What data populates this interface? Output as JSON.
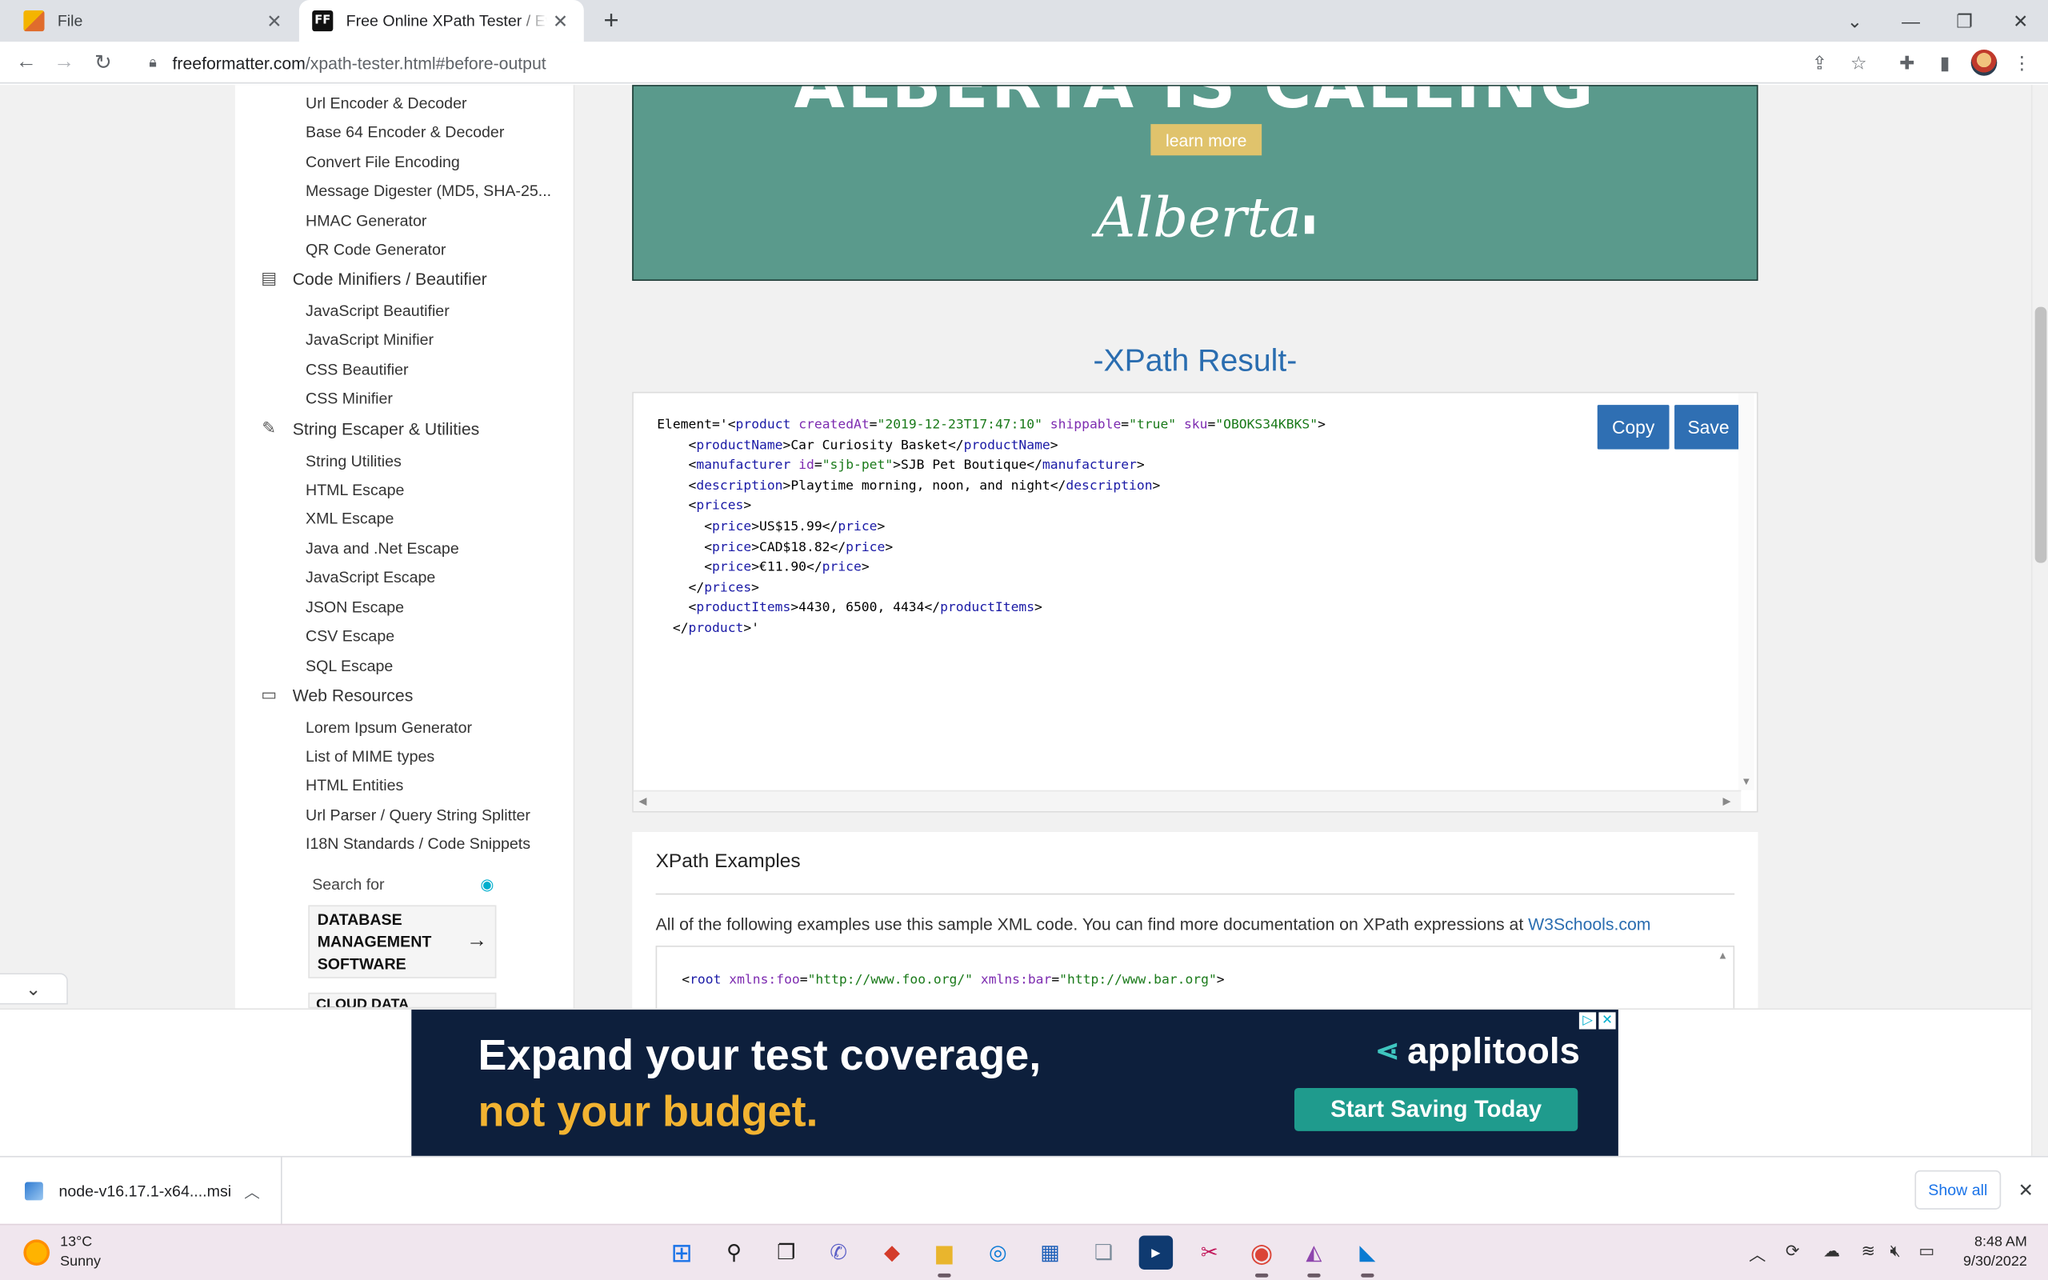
{
  "browser": {
    "tabs": [
      {
        "title": "File",
        "active": false
      },
      {
        "title": "Free Online XPath Tester / Evalua",
        "active": true
      }
    ],
    "favicon_ff": "FF",
    "url_host": "freeformatter.com",
    "url_path": "/xpath-tester.html#before-output"
  },
  "sidebar": {
    "top_items": [
      "Url Encoder & Decoder",
      "Base 64 Encoder & Decoder",
      "Convert File Encoding",
      "Message Digester (MD5, SHA-25...",
      "HMAC Generator",
      "QR Code Generator"
    ],
    "cat_code": "Code Minifiers / Beautifier",
    "code_items": [
      "JavaScript Beautifier",
      "JavaScript Minifier",
      "CSS Beautifier",
      "CSS Minifier"
    ],
    "cat_string": "String Escaper & Utilities",
    "string_items": [
      "String Utilities",
      "HTML Escape",
      "XML Escape",
      "Java and .Net Escape",
      "JavaScript Escape",
      "JSON Escape",
      "CSV Escape",
      "SQL Escape"
    ],
    "cat_web": "Web Resources",
    "web_items": [
      "Lorem Ipsum Generator",
      "List of MIME types",
      "HTML Entities",
      "Url Parser / Query String Splitter",
      "I18N Standards / Code Snippets"
    ],
    "search_for": "Search for",
    "search_card": "DATABASE MANAGEMENT SOFTWARE",
    "search_card_cut": "CLOUD DATA"
  },
  "ad_top": {
    "headline": "ALBERTA IS CALLING",
    "button": "learn more",
    "logo": "Alberta"
  },
  "result": {
    "title": "-XPath Result-",
    "copy": "Copy",
    "save": "Save"
  },
  "examples": {
    "title": "XPath Examples",
    "desc": "All of the following examples use this sample XML code. You can find more documentation on XPath expressions at ",
    "link": "W3Schools.com"
  },
  "bottom_ad": {
    "line1": "Expand your test coverage,",
    "line2": "not your budget.",
    "brand": "applitools",
    "cta": "Start Saving Today"
  },
  "downloads": {
    "file": "node-v16.17.1-x64....msi",
    "show_all": "Show all"
  },
  "taskbar": {
    "temp": "13°C",
    "condition": "Sunny",
    "time": "8:48 AM",
    "date": "9/30/2022"
  },
  "colors": {
    "link_blue": "#2a6db0",
    "button_blue": "#2f6fb3",
    "ad_green": "#5a9a8c",
    "ad_navy": "#0d1f3c",
    "ad_yellow": "#f2b331"
  }
}
